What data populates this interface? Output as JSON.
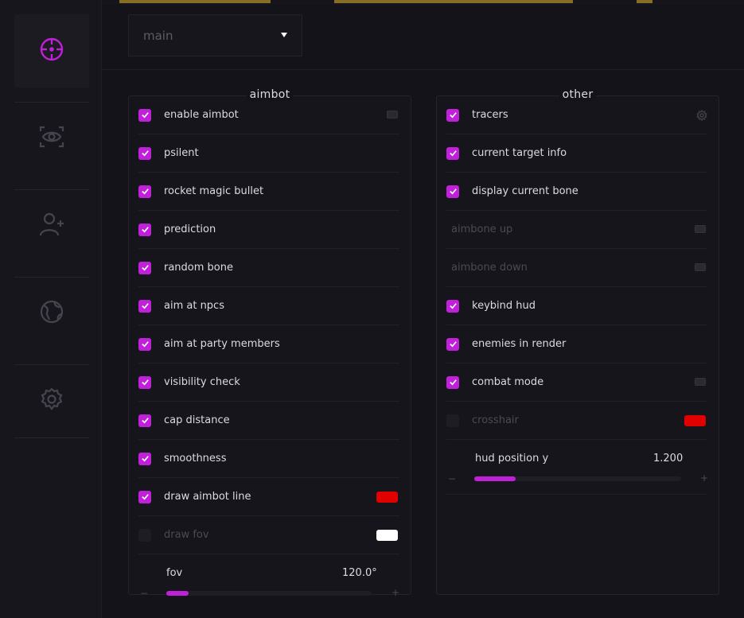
{
  "colors": {
    "accent": "#c020d8",
    "red": "#e00000",
    "white": "#ffffff"
  },
  "sidebar": {
    "items": [
      {
        "icon": "crosshair-icon",
        "active": true
      },
      {
        "icon": "eye-icon",
        "active": false
      },
      {
        "icon": "add-user-icon",
        "active": false
      },
      {
        "icon": "globe-icon",
        "active": false
      },
      {
        "icon": "gear-icon",
        "active": false
      }
    ]
  },
  "header": {
    "select_value": "main"
  },
  "aimbot": {
    "title": "aimbot",
    "rows": [
      {
        "label": "enable aimbot",
        "checked": true,
        "keybind": true
      },
      {
        "label": "psilent",
        "checked": true
      },
      {
        "label": "rocket magic bullet",
        "checked": true
      },
      {
        "label": "prediction",
        "checked": true
      },
      {
        "label": "random bone",
        "checked": true
      },
      {
        "label": "aim at npcs",
        "checked": true
      },
      {
        "label": "aim at party members",
        "checked": true
      },
      {
        "label": "visibility check",
        "checked": true
      },
      {
        "label": "cap distance",
        "checked": true
      },
      {
        "label": "smoothness",
        "checked": true
      },
      {
        "label": "draw aimbot line",
        "checked": true,
        "color": "#e00000"
      },
      {
        "label": "draw fov",
        "checked": false,
        "color": "#ffffff"
      }
    ],
    "slider": {
      "label": "fov",
      "value": "120.0°",
      "fill_fraction": 0.11,
      "minus": "−",
      "plus": "+"
    }
  },
  "other": {
    "title": "other",
    "rows": [
      {
        "label": "tracers",
        "checked": true,
        "settings": true
      },
      {
        "label": "current target info",
        "checked": true
      },
      {
        "label": "display current bone",
        "checked": true
      },
      {
        "label": "aimbone up",
        "checked": null,
        "keybind": true
      },
      {
        "label": "aimbone down",
        "checked": null,
        "keybind": true
      },
      {
        "label": "keybind hud",
        "checked": true
      },
      {
        "label": "enemies in render",
        "checked": true
      },
      {
        "label": "combat mode",
        "checked": true,
        "keybind": true
      },
      {
        "label": "crosshair",
        "checked": false,
        "color": "#e00000"
      }
    ],
    "slider": {
      "label": "hud position y",
      "value": "1.200",
      "fill_fraction": 0.2,
      "minus": "−",
      "plus": "+"
    }
  }
}
